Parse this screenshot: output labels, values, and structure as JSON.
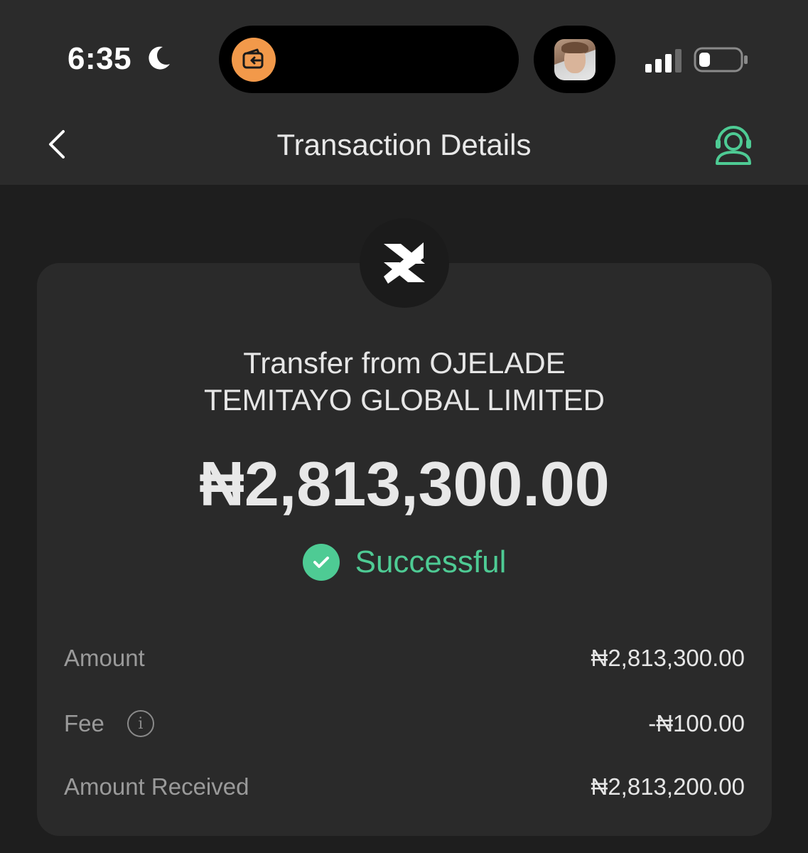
{
  "status_bar": {
    "time": "6:35",
    "moon_icon": "moon-icon",
    "island_icon": "wallet-transfer-icon",
    "signal_icon": "cellular-signal-icon",
    "battery_icon": "battery-icon"
  },
  "header": {
    "title": "Transaction Details",
    "back_icon": "chevron-left-icon",
    "support_icon": "headset-support-icon"
  },
  "transaction": {
    "title": "Transfer from OJELADE TEMITAYO GLOBAL LIMITED",
    "amount": "₦2,813,300.00",
    "status": "Successful",
    "details": [
      {
        "label": "Amount",
        "value": "₦2,813,300.00"
      },
      {
        "label": "Fee",
        "value": "-₦100.00"
      },
      {
        "label": "Amount Received",
        "value": "₦2,813,200.00"
      }
    ]
  },
  "colors": {
    "accent_green": "#4ecb94",
    "island_orange": "#f2994a",
    "background": "#1e1e1e",
    "card": "#2a2a2a",
    "header": "#2b2b2b"
  }
}
